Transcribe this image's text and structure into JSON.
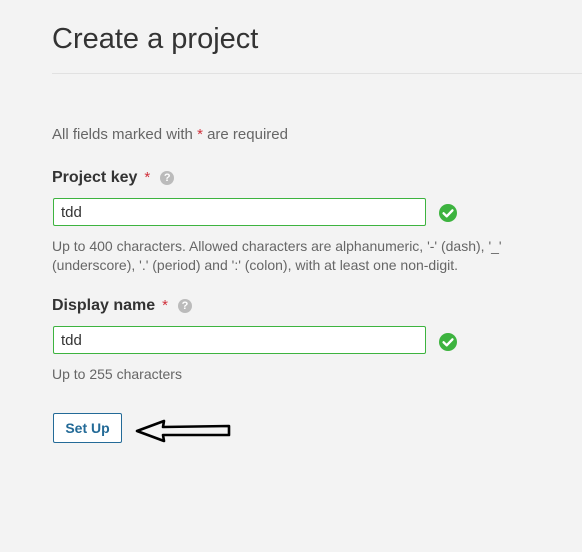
{
  "page": {
    "title": "Create a project"
  },
  "form": {
    "required_note_prefix": "All fields marked with",
    "required_marker": "*",
    "required_note_suffix": "are required",
    "project_key": {
      "label": "Project key",
      "required_marker": "*",
      "help_glyph": "?",
      "value": "tdd",
      "status_icon": "check-circle-icon",
      "hint": "Up to 400 characters. Allowed characters are alphanumeric, '-' (dash), '_' (underscore), '.' (period) and ':' (colon), with at least one non-digit."
    },
    "display_name": {
      "label": "Display name",
      "required_marker": "*",
      "help_glyph": "?",
      "value": "tdd",
      "status_icon": "check-circle-icon",
      "hint": "Up to 255 characters"
    },
    "submit_label": "Set Up"
  },
  "colors": {
    "valid": "#3db33f",
    "required": "#d02f3a",
    "button_accent": "#236a97",
    "background": "#f3f3f3"
  }
}
